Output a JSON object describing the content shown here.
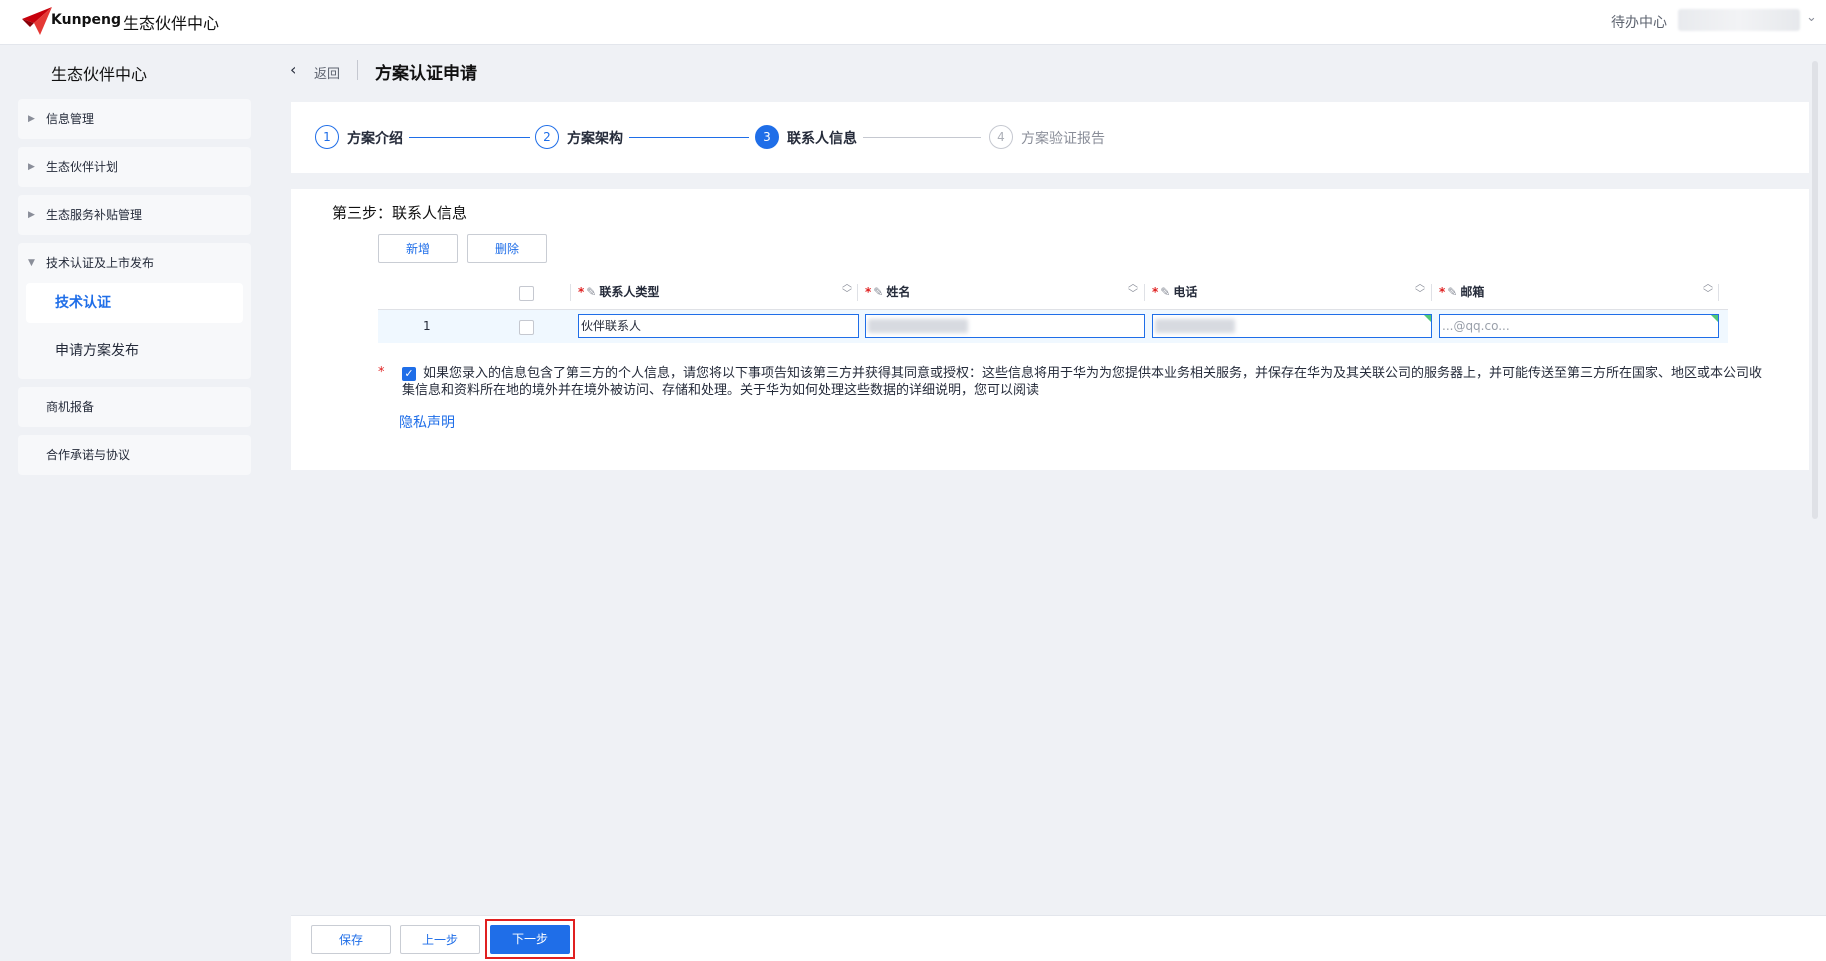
{
  "header": {
    "brand": "Kunpeng",
    "portal_title": "生态伙伴中心",
    "todo_label": "待办中心"
  },
  "sidebar": {
    "title": "生态伙伴中心",
    "groups": [
      {
        "label": "信息管理",
        "expanded": false
      },
      {
        "label": "生态伙伴计划",
        "expanded": false
      },
      {
        "label": "生态服务补贴管理",
        "expanded": false
      },
      {
        "label": "技术认证及上市发布",
        "expanded": true,
        "children": [
          "技术认证",
          "申请方案发布"
        ],
        "active_child": "技术认证"
      },
      {
        "label": "商机报备",
        "expanded": false
      },
      {
        "label": "合作承诺与协议",
        "expanded": false
      }
    ]
  },
  "breadcrumb": {
    "back_label": "返回",
    "page_title": "方案认证申请"
  },
  "steps": [
    {
      "number": "1",
      "label": "方案介绍",
      "state": "done"
    },
    {
      "number": "2",
      "label": "方案架构",
      "state": "done"
    },
    {
      "number": "3",
      "label": "联系人信息",
      "state": "current"
    },
    {
      "number": "4",
      "label": "方案验证报告",
      "state": "todo"
    }
  ],
  "form": {
    "section_title": "第三步：联系人信息",
    "add_button": "新增",
    "delete_button": "删除",
    "columns": [
      "联系人类型",
      "姓名",
      "电话",
      "邮箱"
    ],
    "rows": [
      {
        "index": "1",
        "contact_type": "伙伴联系人",
        "email_visible": "...@qq.co..."
      }
    ],
    "consent_text": "如果您录入的信息包含了第三方的个人信息，请您将以下事项告知该第三方并获得其同意或授权：这些信息将用于华为为您提供本业务相关服务，并保存在华为及其关联公司的服务器上，并可能传送至第三方所在国家、地区或本公司收集信息和资料所在地的境外并在境外被访问、存储和处理。关于华为如何处理这些数据的详细说明，您可以阅读",
    "privacy_link": "隐私声明"
  },
  "footer": {
    "save": "保存",
    "prev": "上一步",
    "next": "下一步"
  },
  "colors": {
    "primary": "#1f6ee8",
    "required": "#e02020",
    "background": "#eff1f5"
  }
}
